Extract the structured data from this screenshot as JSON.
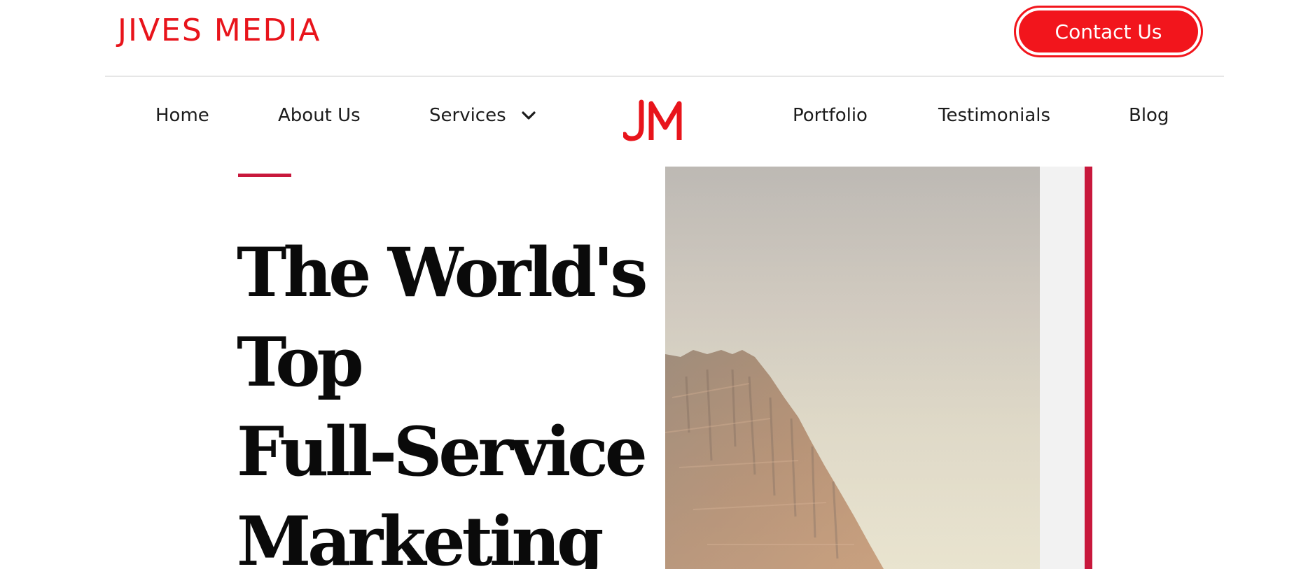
{
  "header": {
    "brand_name": "JIVES MEDIA",
    "contact_label": "Contact Us",
    "logo_icon": "jm-monogram-icon",
    "colors": {
      "brand_red": "#e8141b",
      "accent_crimson": "#c8183c",
      "text_dark": "#1c1c1c"
    }
  },
  "nav": {
    "home": "Home",
    "about": "About Us",
    "services": "Services",
    "services_icon": "chevron-down-icon",
    "portfolio": "Portfolio",
    "testimonials": "Testimonials",
    "blog": "Blog"
  },
  "hero": {
    "title_lines": [
      "The World's",
      "Top",
      "Full-Service",
      "Marketing"
    ],
    "image_icon": "mountain-cliff-photo"
  }
}
